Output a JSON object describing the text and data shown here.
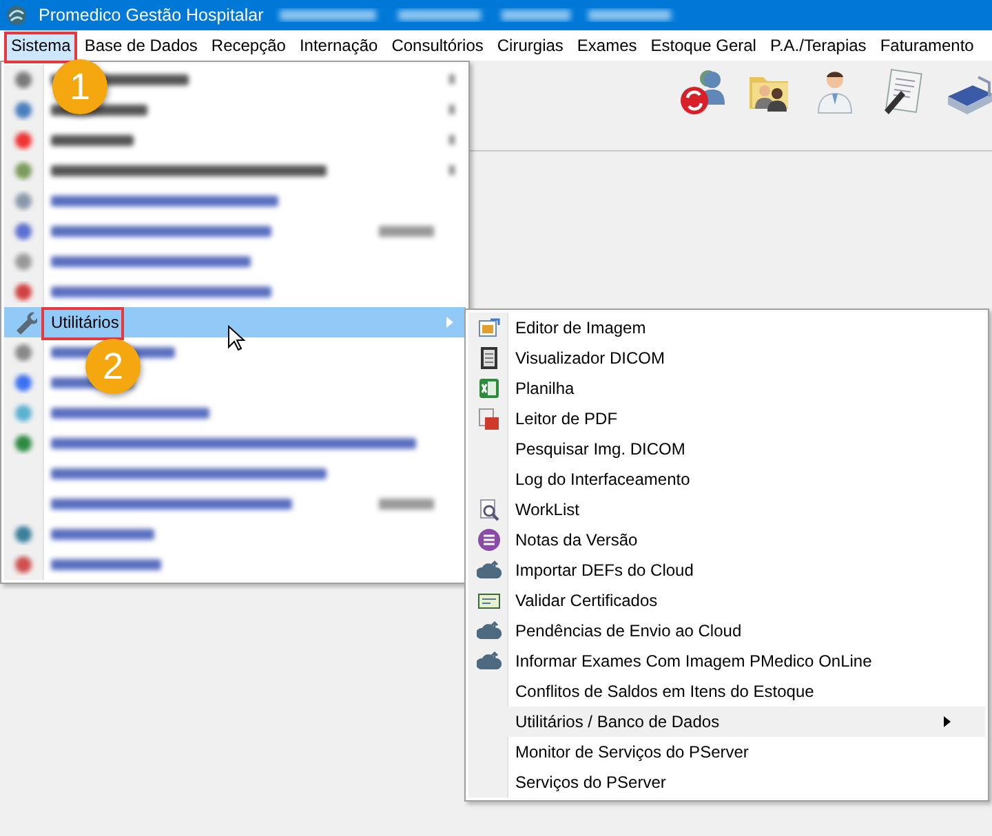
{
  "window": {
    "title": "Promedico Gestão Hospitalar"
  },
  "menubar": [
    {
      "label": "Sistema",
      "selected": true
    },
    {
      "label": "Base de Dados",
      "selected": false
    },
    {
      "label": "Recepção",
      "selected": false
    },
    {
      "label": "Internação",
      "selected": false
    },
    {
      "label": "Consultórios",
      "selected": false
    },
    {
      "label": "Cirurgias",
      "selected": false
    },
    {
      "label": "Exames",
      "selected": false
    },
    {
      "label": "Estoque Geral",
      "selected": false
    },
    {
      "label": "P.A./Terapias",
      "selected": false
    },
    {
      "label": "Faturamento",
      "selected": false
    }
  ],
  "sistema_menu": [
    {
      "kind": "blurred"
    },
    {
      "kind": "blurred"
    },
    {
      "kind": "blurred"
    },
    {
      "kind": "blurred"
    },
    {
      "kind": "blurred"
    },
    {
      "kind": "blurred"
    },
    {
      "kind": "blurred"
    },
    {
      "kind": "blurred"
    },
    {
      "kind": "item",
      "label": "Utilitários",
      "selected": true
    },
    {
      "kind": "blurred"
    },
    {
      "kind": "blurred"
    },
    {
      "kind": "blurred"
    },
    {
      "kind": "blurred"
    },
    {
      "kind": "blurred"
    },
    {
      "kind": "blurred"
    },
    {
      "kind": "blurred"
    },
    {
      "kind": "blurred"
    }
  ],
  "utilitarios_menu": [
    {
      "label": "Editor de Imagem",
      "highlighted": false
    },
    {
      "label": "Visualizador DICOM",
      "highlighted": false
    },
    {
      "label": "Planilha",
      "highlighted": false
    },
    {
      "label": "Leitor de PDF",
      "highlighted": false
    },
    {
      "label": "Pesquisar Img. DICOM",
      "highlighted": false
    },
    {
      "label": "Log do Interfaceamento",
      "highlighted": false
    },
    {
      "label": "WorkList",
      "highlighted": false
    },
    {
      "label": "Notas da Versão",
      "highlighted": false
    },
    {
      "label": "Importar DEFs do Cloud",
      "highlighted": false
    },
    {
      "label": "Validar Certificados",
      "highlighted": false
    },
    {
      "label": "Pendências de Envio ao Cloud",
      "highlighted": false
    },
    {
      "label": "Informar Exames Com Imagem PMedico OnLine",
      "highlighted": false
    },
    {
      "label": "Conflitos de Saldos em Itens do Estoque",
      "highlighted": false
    },
    {
      "label": "Utilitários / Banco de Dados",
      "highlighted": true
    },
    {
      "label": "Monitor de Serviços do PServer",
      "highlighted": false
    },
    {
      "label": "Serviços do PServer",
      "highlighted": false
    }
  ],
  "annotations": [
    {
      "label": "1"
    },
    {
      "label": "2"
    }
  ]
}
